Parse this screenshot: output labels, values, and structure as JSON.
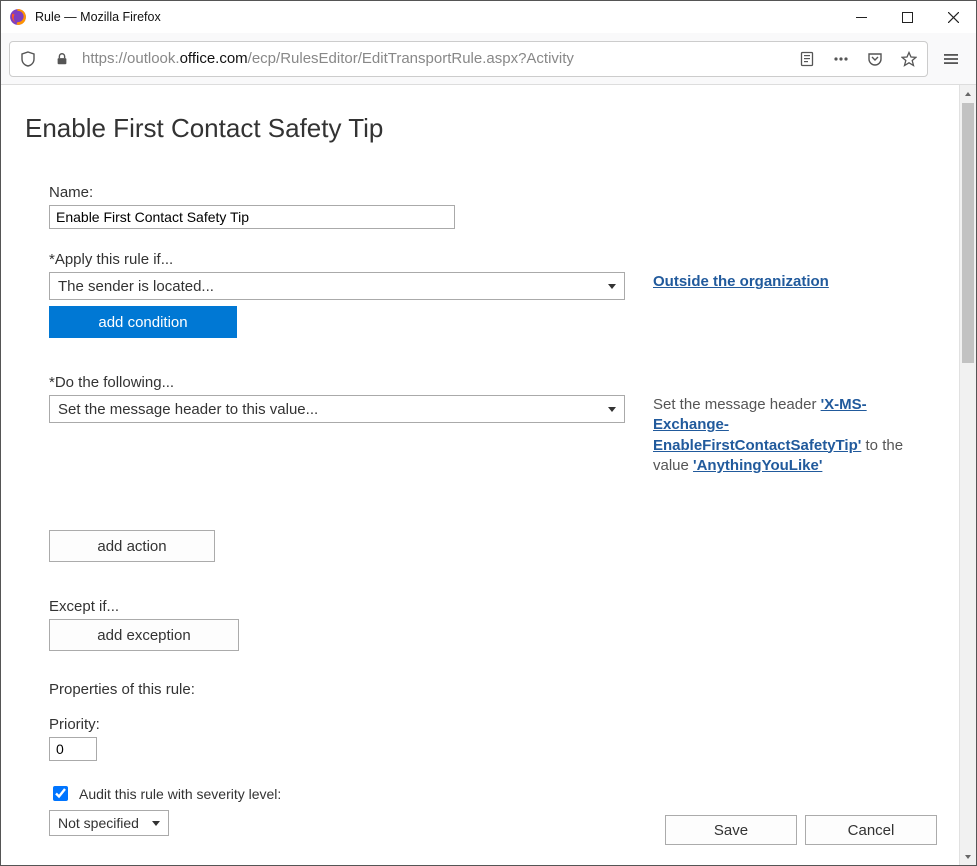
{
  "window": {
    "title": "Rule — Mozilla Firefox"
  },
  "url": {
    "scheme": "https://",
    "sub": "outlook.",
    "host": "office.com",
    "path": "/ecp/RulesEditor/EditTransportRule.aspx?Activity"
  },
  "page": {
    "title": "Enable First Contact Safety Tip",
    "name_label": "Name:",
    "name_value": "Enable First Contact Safety Tip",
    "apply_label": "*Apply this rule if...",
    "apply_value": "The sender is located...",
    "apply_side_link": "Outside the organization",
    "add_condition_label": "add condition",
    "do_label": "*Do the following...",
    "do_value": "Set the message header to this value...",
    "do_side_prefix": "Set the message header ",
    "do_side_header": "'X-MS-Exchange-EnableFirstContactSafetyTip'",
    "do_side_middle": " to the value ",
    "do_side_value": "'AnythingYouLike'",
    "add_action_label": "add action",
    "except_label": "Except if...",
    "add_exception_label": "add exception",
    "props_label": "Properties of this rule:",
    "priority_label": "Priority:",
    "priority_value": "0",
    "audit_checked": true,
    "audit_label": "Audit this rule with severity level:",
    "audit_value": "Not specified",
    "save_label": "Save",
    "cancel_label": "Cancel"
  }
}
